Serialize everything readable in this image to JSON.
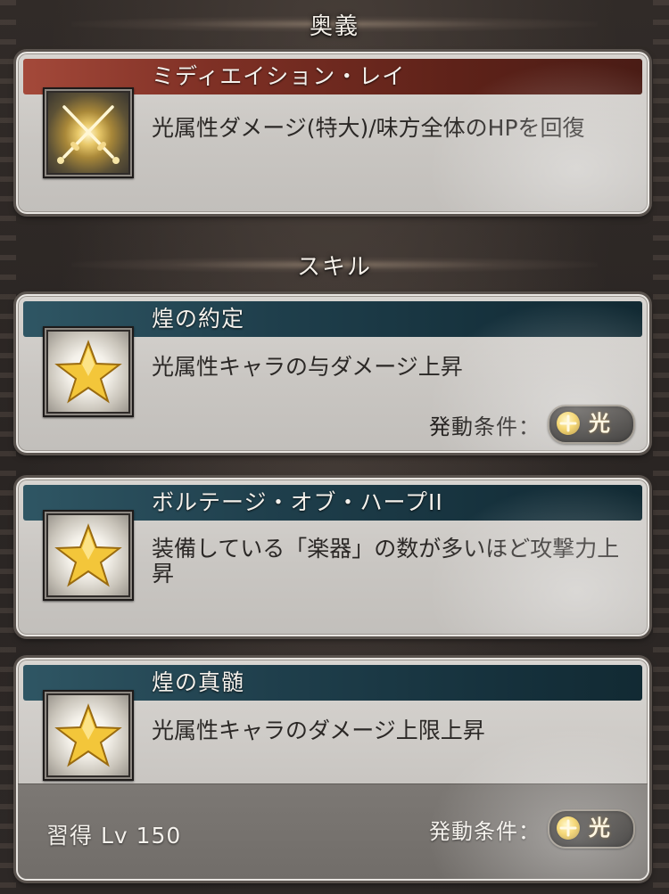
{
  "ougi": {
    "header": "奥義",
    "name": "ミディエイション・レイ",
    "description": "光属性ダメージ(特大)/味方全体のHPを回復",
    "icon": "crossed-swords-icon"
  },
  "skills_header": "スキル",
  "skills": [
    {
      "name": "煌の約定",
      "description": "光属性キャラの与ダメージ上昇",
      "icon": "star-icon",
      "condition_label": "発動条件：",
      "condition_value": "光"
    },
    {
      "name": "ボルテージ・オブ・ハープII",
      "description": "装備している「楽器」の数が多いほど攻撃力上昇",
      "icon": "star-icon"
    },
    {
      "name": "煌の真髄",
      "description": "光属性キャラのダメージ上限上昇",
      "icon": "star-icon",
      "learn_level": "習得 Lv 150",
      "condition_label": "発動条件：",
      "condition_value": "光"
    }
  ],
  "colors": {
    "ougi_title_bar": "#7f3025",
    "skill_title_bar": "#1f3f4c",
    "light_element": "#f1c73c"
  }
}
